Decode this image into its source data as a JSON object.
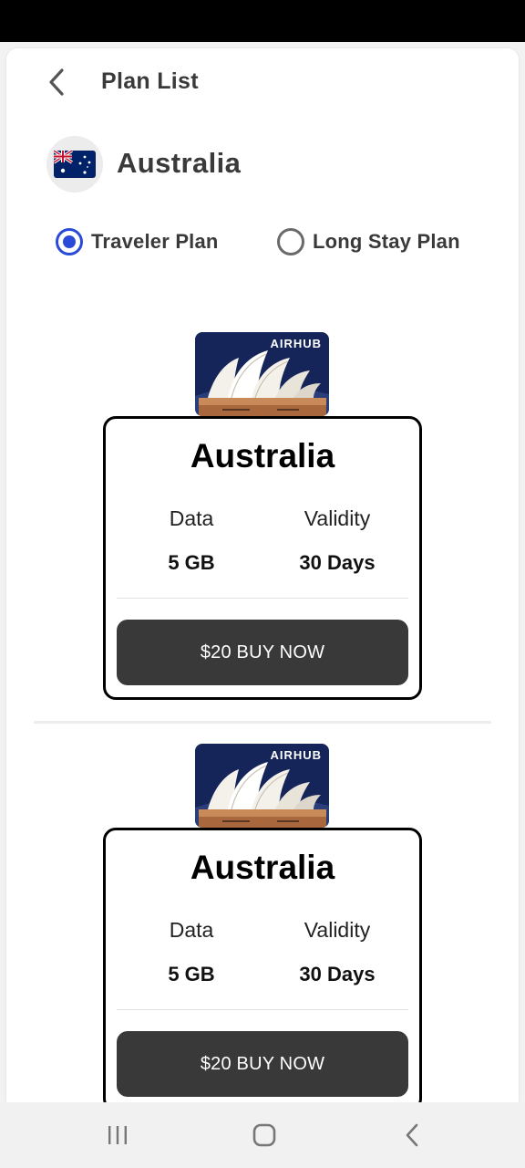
{
  "header": {
    "title": "Plan List",
    "back_icon": "chevron-left-icon"
  },
  "country": {
    "name": "Australia",
    "flag_icon": "australia-flag-icon"
  },
  "plan_types": [
    {
      "label": "Traveler Plan",
      "selected": true
    },
    {
      "label": "Long Stay Plan",
      "selected": false
    }
  ],
  "plans": [
    {
      "sim_brand": "AIRHUB",
      "title": "Australia",
      "data_label": "Data",
      "data_value": "5 GB",
      "validity_label": "Validity",
      "validity_value": "30 Days",
      "button_label": "$20 BUY NOW"
    },
    {
      "sim_brand": "AIRHUB",
      "title": "Australia",
      "data_label": "Data",
      "data_value": "5 GB",
      "validity_label": "Validity",
      "validity_value": "30 Days",
      "button_label": "$20 BUY NOW"
    }
  ],
  "nav": {
    "recents_icon": "recents-icon",
    "home_icon": "home-icon",
    "back_icon": "back-icon"
  },
  "colors": {
    "accent": "#2a4bd8",
    "button": "#393939",
    "sim_bg": "#15255a"
  }
}
